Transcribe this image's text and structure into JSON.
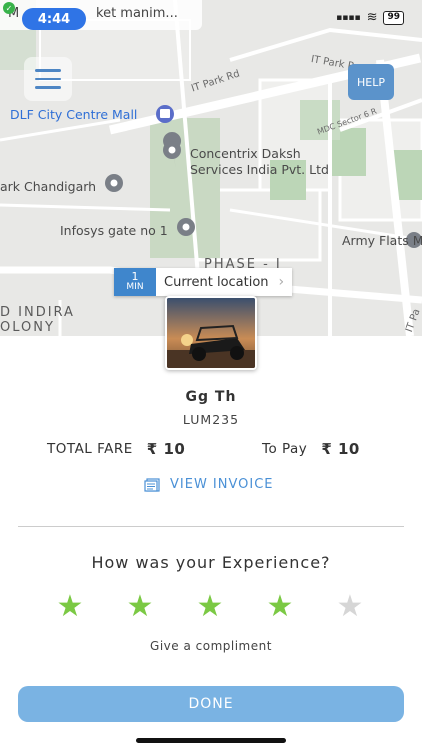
{
  "status_bar": {
    "time": "4:44",
    "banner_left": "M",
    "banner_text": "ket manim...",
    "battery": "99"
  },
  "map": {
    "labels": {
      "mall": "DLF City Centre Mall",
      "concentrix_1": "Concentrix Daksh",
      "concentrix_2": "Services India Pvt. Ltd",
      "chandigarh": "ark Chandigarh",
      "infosys": "Infosys gate no 1",
      "army": "Army Flats M",
      "phase": "PHASE - I",
      "indira_1": "D INDIRA",
      "indira_2": "OLONY",
      "it_park_rd": "IT Park Rd",
      "it_park_top": "IT Park R",
      "mdc": "MDC Sector 6 R",
      "it_park_right": "IT Pa"
    },
    "help_label": "HELP",
    "eta_value": "1",
    "eta_unit": "MIN",
    "current_location": "Current location"
  },
  "trip": {
    "driver_name": "Gg Th",
    "vehicle_number": "LUM235",
    "total_fare_label": "TOTAL FARE",
    "total_fare": "₹ 10",
    "to_pay_label": "To Pay",
    "to_pay": "₹ 10",
    "view_invoice": "VIEW INVOICE"
  },
  "rating": {
    "question": "How was your Experience?",
    "value": 4,
    "max": 5,
    "filled_color": "#7bc944",
    "empty_color": "#d6d6d6",
    "compliment": "Give a compliment"
  },
  "done_label": "DONE"
}
